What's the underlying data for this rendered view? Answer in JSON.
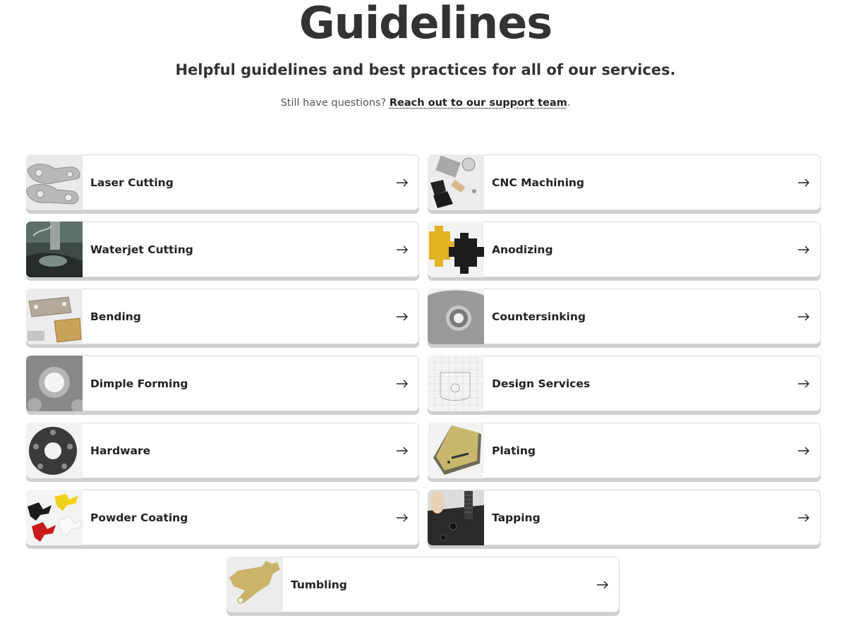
{
  "header": {
    "title": "Guidelines",
    "subtitle": "Helpful guidelines and best practices for all of our services.",
    "support_prefix": "Still have questions? ",
    "support_link": "Reach out to our support team",
    "support_suffix": "."
  },
  "cards": [
    {
      "label": "Laser Cutting",
      "icon": "laser-cutting-thumbnail"
    },
    {
      "label": "CNC Machining",
      "icon": "cnc-machining-thumbnail"
    },
    {
      "label": "Waterjet Cutting",
      "icon": "waterjet-cutting-thumbnail"
    },
    {
      "label": "Anodizing",
      "icon": "anodizing-thumbnail"
    },
    {
      "label": "Bending",
      "icon": "bending-thumbnail"
    },
    {
      "label": "Countersinking",
      "icon": "countersinking-thumbnail"
    },
    {
      "label": "Dimple Forming",
      "icon": "dimple-forming-thumbnail"
    },
    {
      "label": "Design Services",
      "icon": "design-services-thumbnail"
    },
    {
      "label": "Hardware",
      "icon": "hardware-thumbnail"
    },
    {
      "label": "Plating",
      "icon": "plating-thumbnail"
    },
    {
      "label": "Powder Coating",
      "icon": "powder-coating-thumbnail"
    },
    {
      "label": "Tapping",
      "icon": "tapping-thumbnail"
    },
    {
      "label": "Tumbling",
      "icon": "tumbling-thumbnail"
    }
  ],
  "colors": {
    "title": "#333333",
    "card_border": "#d9d9d9",
    "card_shadow": "#cfcfcf",
    "anodize_gold": "#e3b324",
    "powder_red": "#c81a1a",
    "powder_yellow": "#f0d21c"
  }
}
